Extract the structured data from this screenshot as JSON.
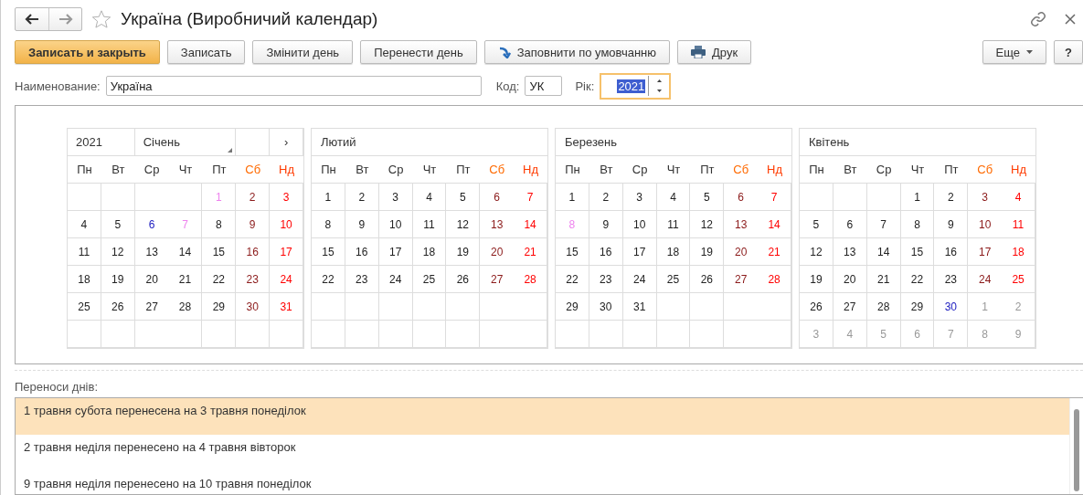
{
  "window": {
    "title": "Україна (Виробничий календар)",
    "favorite": false
  },
  "toolbar": {
    "buttons": [
      {
        "label": "Записать и закрыть",
        "kind": "primary"
      },
      {
        "label": "Записать",
        "kind": "plain"
      },
      {
        "label": "Змінити день",
        "kind": "plain"
      },
      {
        "label": "Перенести день",
        "kind": "plain"
      },
      {
        "label": "Заповнити по умовчанню",
        "kind": "fill"
      },
      {
        "label": "Друк",
        "kind": "print"
      }
    ],
    "more": "Еще",
    "help": "?"
  },
  "fields": {
    "name_label": "Наименование:",
    "name_value": "Україна",
    "code_label": "Код:",
    "code_value": "УК",
    "year_label": "Рік:",
    "year_value": "2021"
  },
  "calendar": {
    "year": "2021",
    "nav_next": "›",
    "months": [
      {
        "name": "Січень",
        "weekdays": [
          {
            "label": "Пн",
            "kind": "work"
          },
          {
            "label": "Вт",
            "kind": "work"
          },
          {
            "label": "Ср",
            "kind": "work"
          },
          {
            "label": "Чт",
            "kind": "work"
          },
          {
            "label": "Пт",
            "kind": "work"
          },
          {
            "label": "Сб",
            "kind": "sat"
          },
          {
            "label": "Нд",
            "kind": "sun"
          }
        ],
        "weeks": [
          [
            {
              "d": "1",
              "kind": "holiday"
            },
            {
              "d": "2",
              "kind": "sat"
            },
            {
              "d": "3",
              "kind": "sun"
            }
          ],
          [
            {
              "d": "4",
              "kind": "work"
            },
            {
              "d": "5",
              "kind": "work"
            },
            {
              "d": "6",
              "kind": "preholiday"
            },
            {
              "d": "7",
              "kind": "holiday"
            },
            {
              "d": "8",
              "kind": "work"
            },
            {
              "d": "9",
              "kind": "sat"
            },
            {
              "d": "10",
              "kind": "sun"
            }
          ],
          [
            {
              "d": "11",
              "kind": "work"
            },
            {
              "d": "12",
              "kind": "work"
            },
            {
              "d": "13",
              "kind": "work"
            },
            {
              "d": "14",
              "kind": "work"
            },
            {
              "d": "15",
              "kind": "work"
            },
            {
              "d": "16",
              "kind": "sat"
            },
            {
              "d": "17",
              "kind": "sun"
            }
          ],
          [
            {
              "d": "18",
              "kind": "work"
            },
            {
              "d": "19",
              "kind": "work"
            },
            {
              "d": "20",
              "kind": "work"
            },
            {
              "d": "21",
              "kind": "work"
            },
            {
              "d": "22",
              "kind": "work"
            },
            {
              "d": "23",
              "kind": "sat"
            },
            {
              "d": "24",
              "kind": "sun"
            }
          ],
          [
            {
              "d": "25",
              "kind": "work"
            },
            {
              "d": "26",
              "kind": "work"
            },
            {
              "d": "27",
              "kind": "work"
            },
            {
              "d": "28",
              "kind": "work"
            },
            {
              "d": "29",
              "kind": "work"
            },
            {
              "d": "30",
              "kind": "sat"
            },
            {
              "d": "31",
              "kind": "sun"
            }
          ]
        ]
      },
      {
        "name": "Лютий",
        "weekdays": [
          {
            "label": "Пн",
            "kind": "work"
          },
          {
            "label": "Вт",
            "kind": "work"
          },
          {
            "label": "Ср",
            "kind": "work"
          },
          {
            "label": "Чт",
            "kind": "work"
          },
          {
            "label": "Пт",
            "kind": "work"
          },
          {
            "label": "Сб",
            "kind": "sat"
          },
          {
            "label": "Нд",
            "kind": "sun"
          }
        ],
        "weeks": [
          [
            {
              "d": "1",
              "kind": "work"
            },
            {
              "d": "2",
              "kind": "work"
            },
            {
              "d": "3",
              "kind": "work"
            },
            {
              "d": "4",
              "kind": "work"
            },
            {
              "d": "5",
              "kind": "work"
            },
            {
              "d": "6",
              "kind": "sat"
            },
            {
              "d": "7",
              "kind": "sun"
            }
          ],
          [
            {
              "d": "8",
              "kind": "work"
            },
            {
              "d": "9",
              "kind": "work"
            },
            {
              "d": "10",
              "kind": "work"
            },
            {
              "d": "11",
              "kind": "work"
            },
            {
              "d": "12",
              "kind": "work"
            },
            {
              "d": "13",
              "kind": "sat"
            },
            {
              "d": "14",
              "kind": "sun"
            }
          ],
          [
            {
              "d": "15",
              "kind": "work"
            },
            {
              "d": "16",
              "kind": "work"
            },
            {
              "d": "17",
              "kind": "work"
            },
            {
              "d": "18",
              "kind": "work"
            },
            {
              "d": "19",
              "kind": "work"
            },
            {
              "d": "20",
              "kind": "sat"
            },
            {
              "d": "21",
              "kind": "sun"
            }
          ],
          [
            {
              "d": "22",
              "kind": "work"
            },
            {
              "d": "23",
              "kind": "work"
            },
            {
              "d": "24",
              "kind": "work"
            },
            {
              "d": "25",
              "kind": "work"
            },
            {
              "d": "26",
              "kind": "work"
            },
            {
              "d": "27",
              "kind": "sat"
            },
            {
              "d": "28",
              "kind": "sun"
            }
          ]
        ]
      },
      {
        "name": "Березень",
        "weekdays": [
          {
            "label": "Пн",
            "kind": "work"
          },
          {
            "label": "Вт",
            "kind": "work"
          },
          {
            "label": "Ср",
            "kind": "work"
          },
          {
            "label": "Чт",
            "kind": "work"
          },
          {
            "label": "Пт",
            "kind": "work"
          },
          {
            "label": "Сб",
            "kind": "sat"
          },
          {
            "label": "Нд",
            "kind": "sun"
          }
        ],
        "weeks": [
          [
            {
              "d": "1",
              "kind": "work"
            },
            {
              "d": "2",
              "kind": "work"
            },
            {
              "d": "3",
              "kind": "work"
            },
            {
              "d": "4",
              "kind": "work"
            },
            {
              "d": "5",
              "kind": "work"
            },
            {
              "d": "6",
              "kind": "sat"
            },
            {
              "d": "7",
              "kind": "sun"
            }
          ],
          [
            {
              "d": "8",
              "kind": "holiday"
            },
            {
              "d": "9",
              "kind": "work"
            },
            {
              "d": "10",
              "kind": "work"
            },
            {
              "d": "11",
              "kind": "work"
            },
            {
              "d": "12",
              "kind": "work"
            },
            {
              "d": "13",
              "kind": "sat"
            },
            {
              "d": "14",
              "kind": "sun"
            }
          ],
          [
            {
              "d": "15",
              "kind": "work"
            },
            {
              "d": "16",
              "kind": "work"
            },
            {
              "d": "17",
              "kind": "work"
            },
            {
              "d": "18",
              "kind": "work"
            },
            {
              "d": "19",
              "kind": "work"
            },
            {
              "d": "20",
              "kind": "sat"
            },
            {
              "d": "21",
              "kind": "sun"
            }
          ],
          [
            {
              "d": "22",
              "kind": "work"
            },
            {
              "d": "23",
              "kind": "work"
            },
            {
              "d": "24",
              "kind": "work"
            },
            {
              "d": "25",
              "kind": "work"
            },
            {
              "d": "26",
              "kind": "work"
            },
            {
              "d": "27",
              "kind": "sat"
            },
            {
              "d": "28",
              "kind": "sun"
            }
          ],
          [
            {
              "d": "29",
              "kind": "work"
            },
            {
              "d": "30",
              "kind": "work"
            },
            {
              "d": "31",
              "kind": "work"
            }
          ]
        ]
      },
      {
        "name": "Квітень",
        "weekdays": [
          {
            "label": "Пн",
            "kind": "work"
          },
          {
            "label": "Вт",
            "kind": "work"
          },
          {
            "label": "Ср",
            "kind": "work"
          },
          {
            "label": "Чт",
            "kind": "work"
          },
          {
            "label": "Пт",
            "kind": "work"
          },
          {
            "label": "Сб",
            "kind": "sat"
          },
          {
            "label": "Нд",
            "kind": "sun"
          }
        ],
        "weeks": [
          [
            {
              "d": "1",
              "kind": "work"
            },
            {
              "d": "2",
              "kind": "work"
            },
            {
              "d": "3",
              "kind": "sat"
            },
            {
              "d": "4",
              "kind": "sun"
            }
          ],
          [
            {
              "d": "5",
              "kind": "work"
            },
            {
              "d": "6",
              "kind": "work"
            },
            {
              "d": "7",
              "kind": "work"
            },
            {
              "d": "8",
              "kind": "work"
            },
            {
              "d": "9",
              "kind": "work"
            },
            {
              "d": "10",
              "kind": "sat"
            },
            {
              "d": "11",
              "kind": "sun"
            }
          ],
          [
            {
              "d": "12",
              "kind": "work"
            },
            {
              "d": "13",
              "kind": "work"
            },
            {
              "d": "14",
              "kind": "work"
            },
            {
              "d": "15",
              "kind": "work"
            },
            {
              "d": "16",
              "kind": "work"
            },
            {
              "d": "17",
              "kind": "sat"
            },
            {
              "d": "18",
              "kind": "sun"
            }
          ],
          [
            {
              "d": "19",
              "kind": "work"
            },
            {
              "d": "20",
              "kind": "work"
            },
            {
              "d": "21",
              "kind": "work"
            },
            {
              "d": "22",
              "kind": "work"
            },
            {
              "d": "23",
              "kind": "work"
            },
            {
              "d": "24",
              "kind": "sat"
            },
            {
              "d": "25",
              "kind": "sun"
            }
          ],
          [
            {
              "d": "26",
              "kind": "work"
            },
            {
              "d": "27",
              "kind": "work"
            },
            {
              "d": "28",
              "kind": "work"
            },
            {
              "d": "29",
              "kind": "work"
            },
            {
              "d": "30",
              "kind": "preholiday"
            },
            {
              "d": "1",
              "kind": "other"
            },
            {
              "d": "2",
              "kind": "other"
            }
          ],
          [
            {
              "d": "3",
              "kind": "other"
            },
            {
              "d": "4",
              "kind": "other"
            },
            {
              "d": "5",
              "kind": "other"
            },
            {
              "d": "6",
              "kind": "other"
            },
            {
              "d": "7",
              "kind": "other"
            },
            {
              "d": "8",
              "kind": "other"
            },
            {
              "d": "9",
              "kind": "other"
            }
          ]
        ]
      }
    ]
  },
  "transfers": {
    "label": "Переноси днів:",
    "rows": [
      {
        "text": "1 травня субота перенесена на 3 травня понеділок",
        "selected": true
      },
      {
        "text": "2 травня неділя перенесено на 4 травня вівторок",
        "selected": false
      },
      {
        "text": "9 травня неділя перенесено на 10 травня понеділок",
        "selected": false
      }
    ]
  }
}
